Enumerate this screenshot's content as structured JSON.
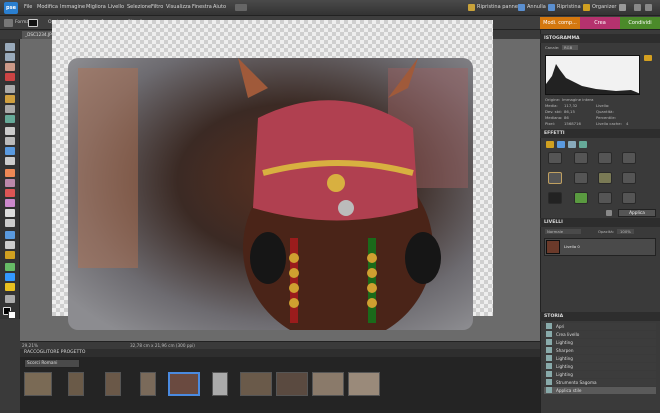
{
  "app": {
    "logo": "pse",
    "menu": [
      "File",
      "Modifica",
      "Immagine",
      "Migliora",
      "Livello",
      "Selezione",
      "Filtro",
      "Visualizza",
      "Finestra",
      "Aiuto"
    ],
    "right_menu": [
      "Ripristina pannelli",
      "Annulla",
      "Ripristina",
      "Organizer"
    ]
  },
  "options": {
    "forma_label": "Forma:",
    "opzioni_forma": "Opzioni forma:",
    "sfuma_label": "Sfuma:",
    "sfuma_value": "0 px",
    "ritaglio": "Ritaglio"
  },
  "modes": {
    "edit": "Modi. comp...",
    "create": "Crea",
    "share": "Condividi"
  },
  "document": {
    "tab": "_DSC1234.JPG @ 29,2% (Livello 0, RGB/8*)",
    "zoom": "29,21%",
    "size": "32,78 cm x 21,96 cm (300 ppi)"
  },
  "project_bin": {
    "title": "RACCOGLITORE PROGETTO",
    "select_value": "Scorci Romani",
    "thumbs": [
      "t1",
      "t2",
      "t3",
      "t4",
      "t5",
      "t6",
      "t7",
      "t8",
      "t9",
      "t10"
    ]
  },
  "histogram": {
    "title": "ISTOGRAMMA",
    "channel_label": "Canale:",
    "channel_value": "RGB",
    "origin_label": "Origine:",
    "origin_value": "Immagine intera",
    "stats": [
      {
        "label": "Media:",
        "value": "117,32"
      },
      {
        "label": "Dev. std:",
        "value": "86,15"
      },
      {
        "label": "Mediana:",
        "value": "86"
      },
      {
        "label": "Pixel:",
        "value": "1568716"
      }
    ],
    "stats_right": [
      {
        "label": "Livello:",
        "value": ""
      },
      {
        "label": "Quantità:",
        "value": ""
      },
      {
        "label": "Percentile:",
        "value": ""
      },
      {
        "label": "Livello cache:",
        "value": "4"
      }
    ]
  },
  "effects": {
    "title": "EFFETTI",
    "apply": "Applica"
  },
  "layers": {
    "title": "LIVELLI",
    "blend_mode": "Normale",
    "opacity_label": "Opacità:",
    "opacity_value": "100%",
    "layer_name": "Livello 0"
  },
  "history": {
    "title": "STORIA",
    "items": [
      "Apri",
      "Crea livello",
      "Lighting",
      "Sharpen",
      "Lighting",
      "Lighting",
      "Lighting",
      "Strumento Sagoma",
      "Applica stile"
    ]
  },
  "colors": {
    "accent_edit": "#d4780f",
    "accent_create": "#b5326e",
    "accent_share": "#4b8a2a"
  }
}
